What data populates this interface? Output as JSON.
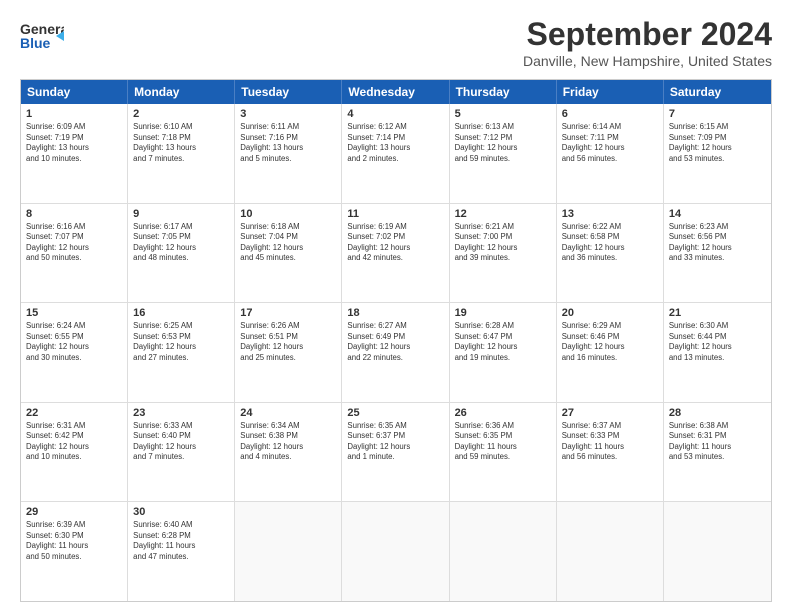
{
  "header": {
    "logo_line1": "General",
    "logo_line2": "Blue",
    "title": "September 2024",
    "subtitle": "Danville, New Hampshire, United States"
  },
  "days_of_week": [
    "Sunday",
    "Monday",
    "Tuesday",
    "Wednesday",
    "Thursday",
    "Friday",
    "Saturday"
  ],
  "weeks": [
    [
      {
        "day": "1",
        "info": "Sunrise: 6:09 AM\nSunset: 7:19 PM\nDaylight: 13 hours\nand 10 minutes."
      },
      {
        "day": "2",
        "info": "Sunrise: 6:10 AM\nSunset: 7:18 PM\nDaylight: 13 hours\nand 7 minutes."
      },
      {
        "day": "3",
        "info": "Sunrise: 6:11 AM\nSunset: 7:16 PM\nDaylight: 13 hours\nand 5 minutes."
      },
      {
        "day": "4",
        "info": "Sunrise: 6:12 AM\nSunset: 7:14 PM\nDaylight: 13 hours\nand 2 minutes."
      },
      {
        "day": "5",
        "info": "Sunrise: 6:13 AM\nSunset: 7:12 PM\nDaylight: 12 hours\nand 59 minutes."
      },
      {
        "day": "6",
        "info": "Sunrise: 6:14 AM\nSunset: 7:11 PM\nDaylight: 12 hours\nand 56 minutes."
      },
      {
        "day": "7",
        "info": "Sunrise: 6:15 AM\nSunset: 7:09 PM\nDaylight: 12 hours\nand 53 minutes."
      }
    ],
    [
      {
        "day": "8",
        "info": "Sunrise: 6:16 AM\nSunset: 7:07 PM\nDaylight: 12 hours\nand 50 minutes."
      },
      {
        "day": "9",
        "info": "Sunrise: 6:17 AM\nSunset: 7:05 PM\nDaylight: 12 hours\nand 48 minutes."
      },
      {
        "day": "10",
        "info": "Sunrise: 6:18 AM\nSunset: 7:04 PM\nDaylight: 12 hours\nand 45 minutes."
      },
      {
        "day": "11",
        "info": "Sunrise: 6:19 AM\nSunset: 7:02 PM\nDaylight: 12 hours\nand 42 minutes."
      },
      {
        "day": "12",
        "info": "Sunrise: 6:21 AM\nSunset: 7:00 PM\nDaylight: 12 hours\nand 39 minutes."
      },
      {
        "day": "13",
        "info": "Sunrise: 6:22 AM\nSunset: 6:58 PM\nDaylight: 12 hours\nand 36 minutes."
      },
      {
        "day": "14",
        "info": "Sunrise: 6:23 AM\nSunset: 6:56 PM\nDaylight: 12 hours\nand 33 minutes."
      }
    ],
    [
      {
        "day": "15",
        "info": "Sunrise: 6:24 AM\nSunset: 6:55 PM\nDaylight: 12 hours\nand 30 minutes."
      },
      {
        "day": "16",
        "info": "Sunrise: 6:25 AM\nSunset: 6:53 PM\nDaylight: 12 hours\nand 27 minutes."
      },
      {
        "day": "17",
        "info": "Sunrise: 6:26 AM\nSunset: 6:51 PM\nDaylight: 12 hours\nand 25 minutes."
      },
      {
        "day": "18",
        "info": "Sunrise: 6:27 AM\nSunset: 6:49 PM\nDaylight: 12 hours\nand 22 minutes."
      },
      {
        "day": "19",
        "info": "Sunrise: 6:28 AM\nSunset: 6:47 PM\nDaylight: 12 hours\nand 19 minutes."
      },
      {
        "day": "20",
        "info": "Sunrise: 6:29 AM\nSunset: 6:46 PM\nDaylight: 12 hours\nand 16 minutes."
      },
      {
        "day": "21",
        "info": "Sunrise: 6:30 AM\nSunset: 6:44 PM\nDaylight: 12 hours\nand 13 minutes."
      }
    ],
    [
      {
        "day": "22",
        "info": "Sunrise: 6:31 AM\nSunset: 6:42 PM\nDaylight: 12 hours\nand 10 minutes."
      },
      {
        "day": "23",
        "info": "Sunrise: 6:33 AM\nSunset: 6:40 PM\nDaylight: 12 hours\nand 7 minutes."
      },
      {
        "day": "24",
        "info": "Sunrise: 6:34 AM\nSunset: 6:38 PM\nDaylight: 12 hours\nand 4 minutes."
      },
      {
        "day": "25",
        "info": "Sunrise: 6:35 AM\nSunset: 6:37 PM\nDaylight: 12 hours\nand 1 minute."
      },
      {
        "day": "26",
        "info": "Sunrise: 6:36 AM\nSunset: 6:35 PM\nDaylight: 11 hours\nand 59 minutes."
      },
      {
        "day": "27",
        "info": "Sunrise: 6:37 AM\nSunset: 6:33 PM\nDaylight: 11 hours\nand 56 minutes."
      },
      {
        "day": "28",
        "info": "Sunrise: 6:38 AM\nSunset: 6:31 PM\nDaylight: 11 hours\nand 53 minutes."
      }
    ],
    [
      {
        "day": "29",
        "info": "Sunrise: 6:39 AM\nSunset: 6:30 PM\nDaylight: 11 hours\nand 50 minutes."
      },
      {
        "day": "30",
        "info": "Sunrise: 6:40 AM\nSunset: 6:28 PM\nDaylight: 11 hours\nand 47 minutes."
      },
      {
        "day": "",
        "info": ""
      },
      {
        "day": "",
        "info": ""
      },
      {
        "day": "",
        "info": ""
      },
      {
        "day": "",
        "info": ""
      },
      {
        "day": "",
        "info": ""
      }
    ]
  ]
}
